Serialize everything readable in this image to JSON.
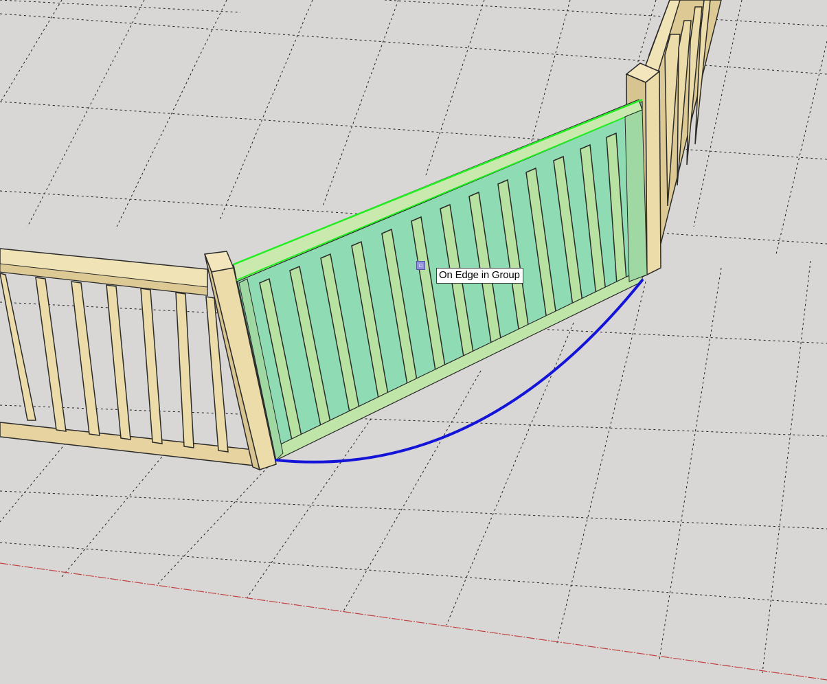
{
  "app": "SketchUp",
  "tool": "Arc",
  "inference_tooltip": "On Edge in Group",
  "colors": {
    "background": "#d9d7d5",
    "grid": "#1e1e1e",
    "red_axis": "#c04040",
    "wood": "#ecdcaa",
    "wood_shade": "#cdb98a",
    "selection_fill": "#8fdcb4",
    "selection_edge": "#22ee22",
    "arc": "#1414d8"
  },
  "icons": [
    "inference-point-icon"
  ]
}
